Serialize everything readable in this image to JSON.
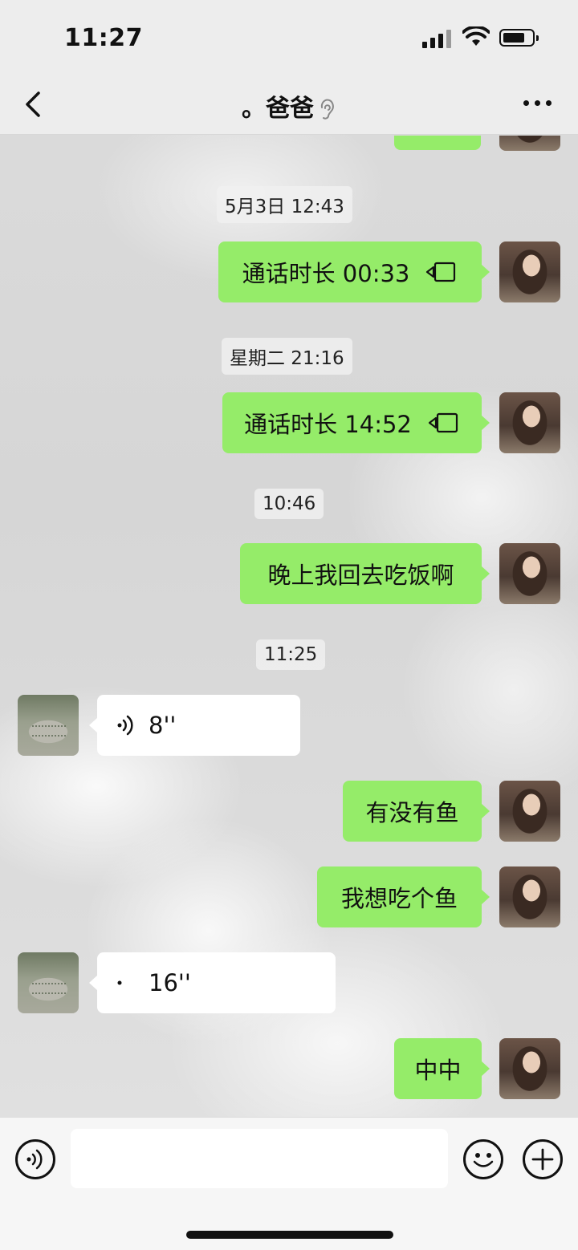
{
  "status_bar": {
    "time": "11:27"
  },
  "header": {
    "title": "。爸爸"
  },
  "messages": [
    {
      "type": "outgoing-cut",
      "text": ""
    },
    {
      "type": "timestamp",
      "text": "5月3日 12:43"
    },
    {
      "type": "outgoing-call",
      "text": "通话时长 00:33"
    },
    {
      "type": "timestamp",
      "text": "星期二 21:16"
    },
    {
      "type": "outgoing-call",
      "text": "通话时长 14:52"
    },
    {
      "type": "timestamp",
      "text": "10:46"
    },
    {
      "type": "outgoing",
      "text": "晚上我回去吃饭啊"
    },
    {
      "type": "timestamp",
      "text": "11:25"
    },
    {
      "type": "incoming-voice",
      "text": "8''"
    },
    {
      "type": "outgoing",
      "text": "有没有鱼"
    },
    {
      "type": "outgoing",
      "text": "我想吃个鱼"
    },
    {
      "type": "incoming-voice",
      "text": "16''"
    },
    {
      "type": "outgoing",
      "text": "中中"
    }
  ],
  "input_bar": {
    "value": ""
  },
  "colors": {
    "outgoing_bubble": "#95ec69",
    "incoming_bubble": "#ffffff",
    "bar_bg": "#ededed"
  },
  "icons": [
    "back-icon",
    "ear-icon",
    "more-icon",
    "video-call-icon",
    "voice-wave-icon",
    "voice-input-icon",
    "emoji-icon",
    "plus-icon"
  ]
}
